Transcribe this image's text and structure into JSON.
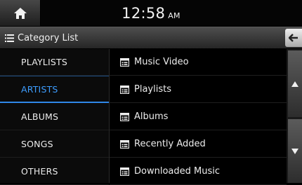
{
  "status_bar": {
    "home_icon": "home-icon",
    "time": "12:58",
    "ampm": "AM"
  },
  "header": {
    "menu_icon": "list-icon",
    "title": "Category List",
    "back_icon": "back-arrow-icon"
  },
  "categories": [
    {
      "label": "PLAYLISTS",
      "selected": false
    },
    {
      "label": "ARTISTS",
      "selected": true
    },
    {
      "label": "ALBUMS",
      "selected": false
    },
    {
      "label": "SONGS",
      "selected": false
    },
    {
      "label": "OTHERS",
      "selected": false
    }
  ],
  "items": [
    {
      "label": "Music Video",
      "icon": "folder-list-icon"
    },
    {
      "label": "Playlists",
      "icon": "folder-list-icon"
    },
    {
      "label": "Albums",
      "icon": "folder-list-icon"
    },
    {
      "label": "Recently Added",
      "icon": "folder-list-icon"
    },
    {
      "label": "Downloaded Music",
      "icon": "folder-list-icon"
    }
  ],
  "scroll": {
    "up_icon": "scroll-up-icon",
    "down_icon": "scroll-down-icon"
  },
  "colors": {
    "accent": "#3d9dff",
    "background": "#000000"
  }
}
